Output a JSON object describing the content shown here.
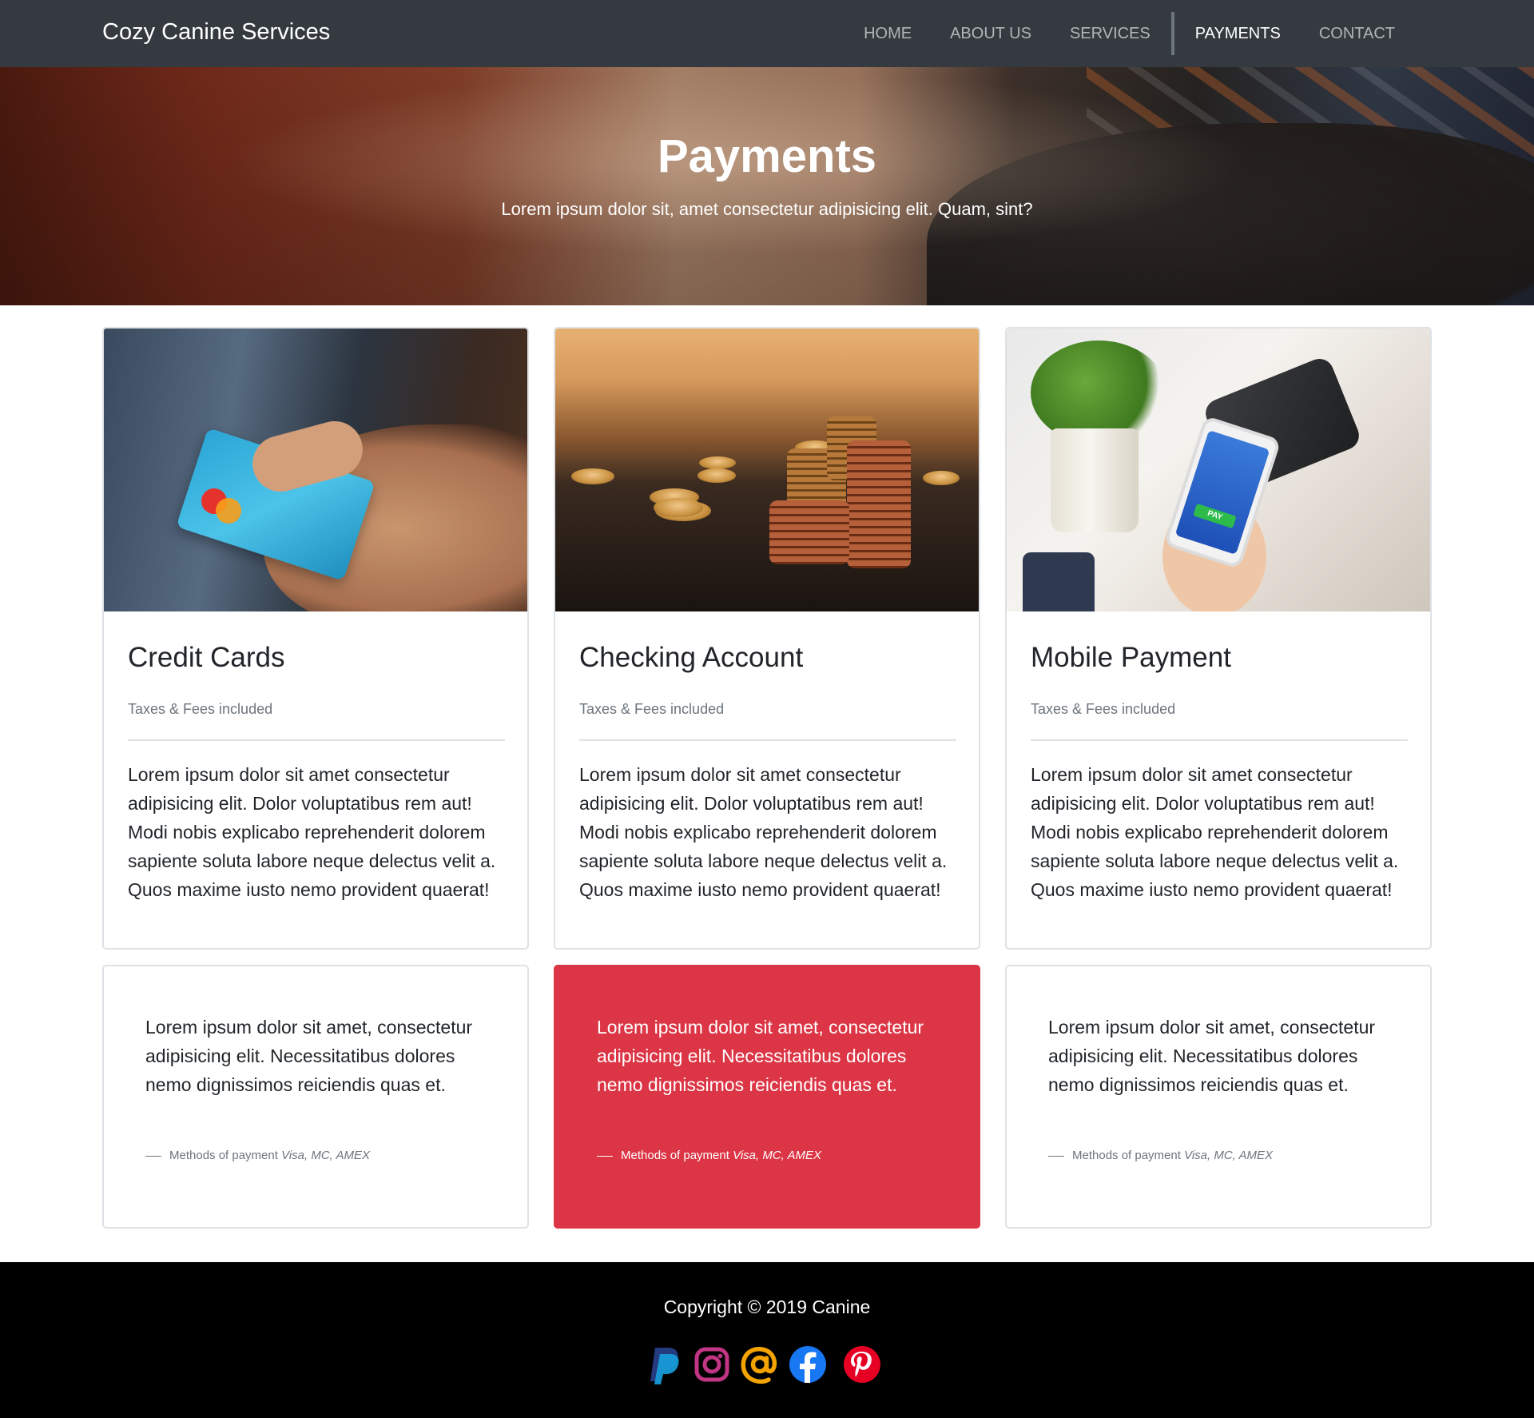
{
  "navbar": {
    "brand": "Cozy Canine Services",
    "items": [
      {
        "label": "HOME"
      },
      {
        "label": "ABOUT US"
      },
      {
        "label": "SERVICES"
      },
      {
        "label": "PAYMENTS",
        "active": true
      },
      {
        "label": "CONTACT"
      }
    ]
  },
  "hero": {
    "title": "Payments",
    "subtitle": "Lorem ipsum dolor sit, amet consectetur adipisicing elit. Quam, sint?"
  },
  "cards": [
    {
      "title": "Credit Cards",
      "subtitle": "Taxes & Fees included",
      "text": "Lorem ipsum dolor sit amet consectetur adipisicing elit. Dolor voluptatibus rem aut! Modi nobis explicabo reprehenderit dolorem sapiente soluta labore neque delectus velit a. Quos maxime iusto nemo provident quaerat!"
    },
    {
      "title": "Checking Account",
      "subtitle": "Taxes & Fees included",
      "text": "Lorem ipsum dolor sit amet consectetur adipisicing elit. Dolor voluptatibus rem aut! Modi nobis explicabo reprehenderit dolorem sapiente soluta labore neque delectus velit a. Quos maxime iusto nemo provident quaerat!"
    },
    {
      "title": "Mobile Payment",
      "subtitle": "Taxes & Fees included",
      "text": "Lorem ipsum dolor sit amet consectetur adipisicing elit. Dolor voluptatibus rem aut! Modi nobis explicabo reprehenderit dolorem sapiente soluta labore neque delectus velit a. Quos maxime iusto nemo provident quaerat!"
    }
  ],
  "quotes": [
    {
      "text": "Lorem ipsum dolor sit amet, consectetur adipisicing elit. Necessitatibus dolores nemo dignissimos reiciendis quas et.",
      "footer": "Methods of payment",
      "cite": "Visa, MC, AMEX"
    },
    {
      "text": "Lorem ipsum dolor sit amet, consectetur adipisicing elit. Necessitatibus dolores nemo dignissimos reiciendis quas et.",
      "footer": "Methods of payment",
      "cite": "Visa, MC, AMEX"
    },
    {
      "text": "Lorem ipsum dolor sit amet, consectetur adipisicing elit. Necessitatibus dolores nemo dignissimos reiciendis quas et.",
      "footer": "Methods of payment",
      "cite": "Visa, MC, AMEX"
    }
  ],
  "footer": {
    "copyright": "Copyright © 2019 Canine",
    "socials": [
      {
        "icon": "paypal-icon",
        "color": "#253b80"
      },
      {
        "icon": "instagram-icon",
        "color": "#c13584"
      },
      {
        "icon": "at-sign-icon",
        "color": "#f4a300"
      },
      {
        "icon": "facebook-icon",
        "color": "#1877f2"
      },
      {
        "icon": "pinterest-icon",
        "color": "#e60023"
      }
    ]
  },
  "colors": {
    "navbar_bg": "#343a40",
    "danger": "#dc3545",
    "footer_bg": "#000000",
    "muted": "#6c757d"
  }
}
